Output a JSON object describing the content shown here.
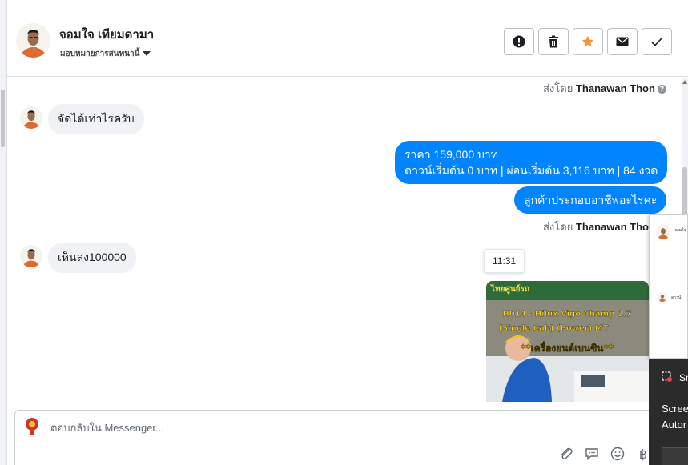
{
  "header": {
    "contact_name": "จอมใจ เทียมดามา",
    "assign_label": "มอบหมายการสนทนานี้",
    "actions": [
      {
        "name": "spam-button",
        "icon": "alert-icon"
      },
      {
        "name": "delete-button",
        "icon": "trash-icon"
      },
      {
        "name": "star-button",
        "icon": "star-icon",
        "color": "#f7923b"
      },
      {
        "name": "mark-unread-button",
        "icon": "envelope-icon"
      },
      {
        "name": "mark-done-button",
        "icon": "check-icon"
      }
    ]
  },
  "chat": {
    "sent_by_1": {
      "prefix": "ส่งโดย",
      "name": "Thanawan Thon"
    },
    "msg_in_1": "จัดได้เท่าไรครับ",
    "msg_out_1_line1": "ราคา 159,000 บาท",
    "msg_out_1_line2": "ดาวน์เริ่มต้น 0 บาท | ผ่อนเริ่มต้น 3,116 บาท | 84 งวด",
    "msg_out_2": "ลูกค้าประกอบอาชีพอะไรคะ",
    "sent_by_2": {
      "prefix": "ส่งโดย",
      "name": "Thanawan Thon"
    },
    "msg_in_2": "เห็นลง100000",
    "time": "11:31",
    "image_text": {
      "header": "ไทยศูนย์รถ",
      "line1": "H014 - Hilux Vigo Champ 2.7",
      "line2": "(Single Cab) (Power) MT",
      "line3": "**เครื่องยนต์เบนซิน**"
    }
  },
  "composer": {
    "placeholder": "ตอบกลับใน Messenger..."
  },
  "overlay": {
    "popup_line1": "จอมใจ",
    "popup_line2": "ดาวน์",
    "snip_title": "Sn",
    "snip_line1": "Scree",
    "snip_line2": "Autor"
  },
  "colors": {
    "accent_blue": "#0084ff",
    "bubble_gray": "#f0f2f5",
    "star_orange": "#f7923b"
  }
}
